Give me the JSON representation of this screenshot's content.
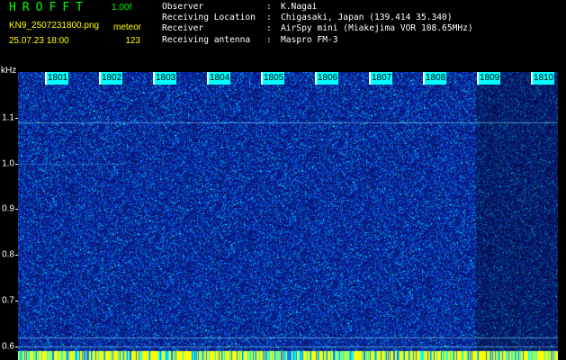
{
  "header": {
    "app_title": "HROFFT",
    "version": "1.00f",
    "filename": "KN9_2507231800.png",
    "meteor_label": "meteor",
    "datetime": "25.07.23 18:00",
    "meteor_count": "123"
  },
  "info": [
    {
      "key": "Observer",
      "sep": ":",
      "value": "K.Nagai"
    },
    {
      "key": "Receiving Location",
      "sep": ":",
      "value": "Chigasaki, Japan (139.414 35.340)"
    },
    {
      "key": "Receiver",
      "sep": ":",
      "value": "AirSpy mini (Miakejima VOR 108.65MHz)"
    },
    {
      "key": "Receiving antenna",
      "sep": ":",
      "value": "Maspro FM-3"
    }
  ],
  "axis": {
    "unit": "kHz",
    "y_ticks": [
      "1.1",
      "1.0",
      "0.9",
      "0.8",
      "0.7",
      "0.6"
    ],
    "y_values": [
      1.1,
      1.0,
      0.9,
      0.8,
      0.7,
      0.6
    ],
    "y_range": [
      0.57,
      1.2
    ],
    "time_labels": [
      "1801",
      "1802",
      "1803",
      "1804",
      "1805",
      "1806",
      "1807",
      "1808",
      "1809",
      "1810"
    ]
  },
  "colors": {
    "title": "#00ff00",
    "meta": "#ffff00",
    "label_bg": "#00ffff",
    "noise_base": "#0a1a7a",
    "noise_high": "#00ffff"
  },
  "signals": [
    {
      "name": "carrier-1.09",
      "freq_khz": 1.09
    },
    {
      "name": "carrier-0.62",
      "freq_khz": 0.62
    },
    {
      "name": "carrier-0.60",
      "freq_khz": 0.6
    }
  ]
}
